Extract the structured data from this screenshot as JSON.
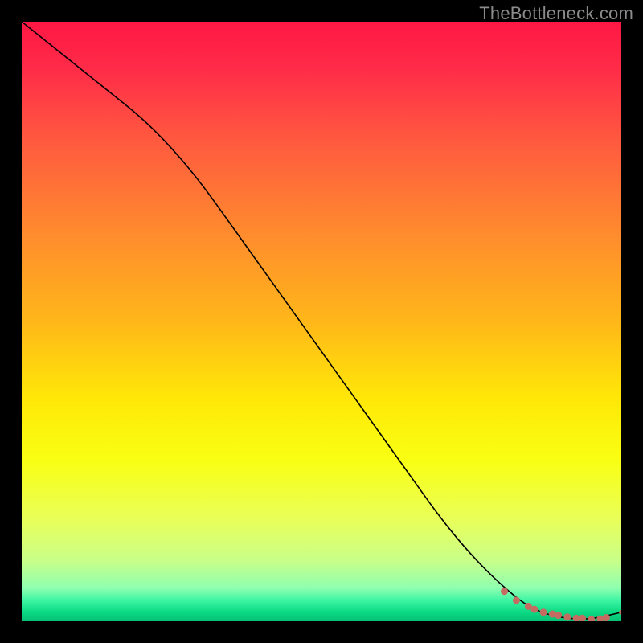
{
  "watermark": "TheBottleneck.com",
  "chart_data": {
    "type": "line",
    "title": "",
    "xlabel": "",
    "ylabel": "",
    "xlim": [
      0,
      100
    ],
    "ylim": [
      0,
      100
    ],
    "grid": false,
    "legend": false,
    "series": [
      {
        "name": "curve",
        "x": [
          0,
          5,
          10,
          15,
          20,
          25,
          30,
          35,
          40,
          45,
          50,
          55,
          60,
          65,
          70,
          75,
          80,
          85,
          90,
          95,
          100
        ],
        "y": [
          100,
          96,
          92,
          88,
          84,
          79,
          73,
          66,
          59,
          52,
          45,
          38,
          31,
          24,
          17,
          11,
          6,
          2,
          0.5,
          0.3,
          1.5
        ]
      }
    ],
    "markers": {
      "name": "highlight-dots",
      "x": [
        80.5,
        82.5,
        84.5,
        85.5,
        87.0,
        88.5,
        89.5,
        91.0,
        92.5,
        93.5,
        95.0,
        96.5,
        97.5,
        100.0
      ],
      "y": [
        5.0,
        3.5,
        2.5,
        2.0,
        1.5,
        1.2,
        1.0,
        0.7,
        0.5,
        0.5,
        0.3,
        0.4,
        0.6,
        1.5
      ],
      "r": [
        4.5,
        4.5,
        4.5,
        4.5,
        4.5,
        4.5,
        4.5,
        4.5,
        4.5,
        4.5,
        4.5,
        4.5,
        4.5,
        2.8
      ]
    },
    "colors": {
      "line": "#000000",
      "marker": "#c46b62",
      "gradient_stops": [
        {
          "offset": 0.0,
          "color": "#ff1744"
        },
        {
          "offset": 0.08,
          "color": "#ff2c48"
        },
        {
          "offset": 0.2,
          "color": "#ff5a3f"
        },
        {
          "offset": 0.35,
          "color": "#ff8a2e"
        },
        {
          "offset": 0.5,
          "color": "#ffb719"
        },
        {
          "offset": 0.63,
          "color": "#ffe807"
        },
        {
          "offset": 0.73,
          "color": "#f9ff12"
        },
        {
          "offset": 0.83,
          "color": "#e9ff59"
        },
        {
          "offset": 0.9,
          "color": "#c8ff8a"
        },
        {
          "offset": 0.945,
          "color": "#8dffb0"
        },
        {
          "offset": 0.965,
          "color": "#3df5a3"
        },
        {
          "offset": 0.985,
          "color": "#0bd983"
        },
        {
          "offset": 1.0,
          "color": "#07c074"
        }
      ]
    }
  }
}
